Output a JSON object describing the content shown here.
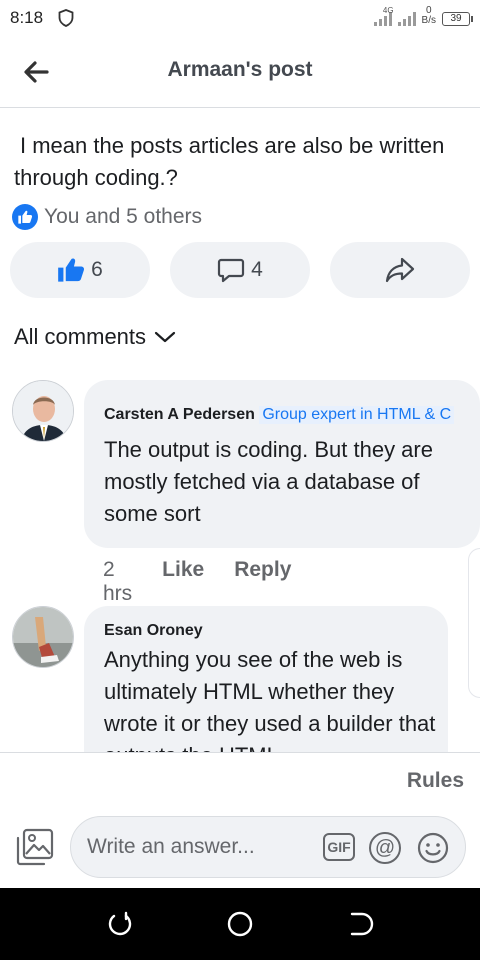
{
  "status_bar": {
    "time": "8:18",
    "network": "4G",
    "speed_value": "0",
    "speed_unit": "B/s",
    "battery": "39"
  },
  "header": {
    "title": "Armaan's post"
  },
  "post": {
    "text": "I mean the posts articles are also be written through coding.?",
    "reactions_text": "You and 5 others",
    "like_count": "6",
    "comment_count": "4"
  },
  "comments_section": {
    "filter_label": "All comments"
  },
  "comments": [
    {
      "author": "Carsten A Pedersen",
      "badge": "Group expert in HTML & C",
      "text": "The output is coding. But they are mostly fetched via a database of some sort",
      "time": "2 hrs",
      "like_label": "Like",
      "reply_label": "Reply"
    },
    {
      "author": "Esan Oroney",
      "text": "Anything you see of the web is ultimately HTML whether they wrote it or they used a builder that outputs the HTML"
    }
  ],
  "footer": {
    "rules_label": "Rules",
    "input_placeholder": "Write an answer...",
    "gif_label": "GIF",
    "at_label": "@"
  },
  "colors": {
    "accent": "#1877f2",
    "bubble": "#f0f2f5",
    "muted_text": "#65676b"
  }
}
